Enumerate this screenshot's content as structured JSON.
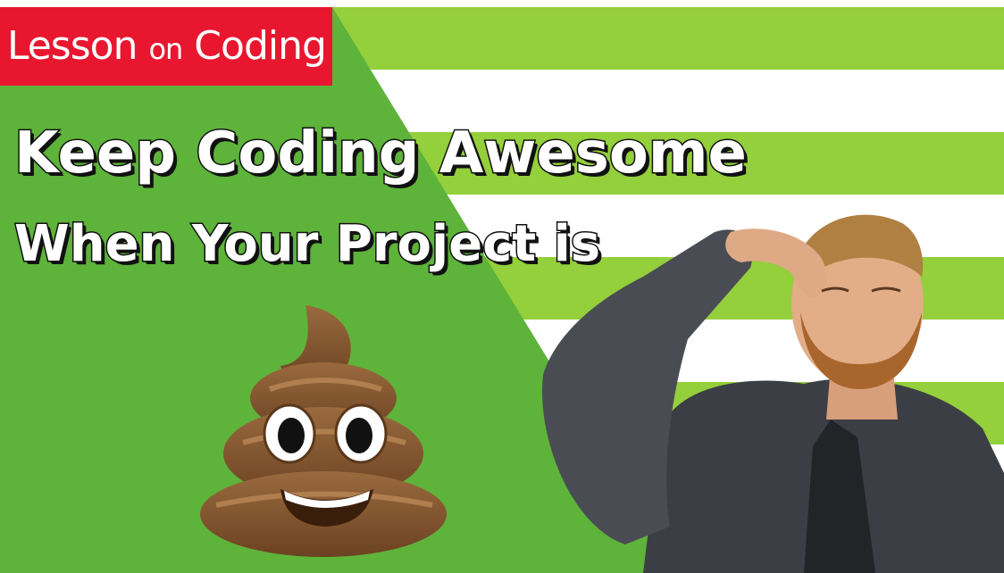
{
  "badge": {
    "prefix": "Lesson ",
    "small": "on",
    "suffix": " Coding"
  },
  "headline": {
    "line1": "Keep Coding Awesome",
    "line2": "When Your Project is"
  },
  "icons": {
    "emoji": "pile-of-poo-icon",
    "person": "person-holding-nose"
  },
  "colors": {
    "green": "#5eb33a",
    "lime": "#94cf3c",
    "white": "#ffffff",
    "red": "#e8172f",
    "outline": "#111111"
  }
}
